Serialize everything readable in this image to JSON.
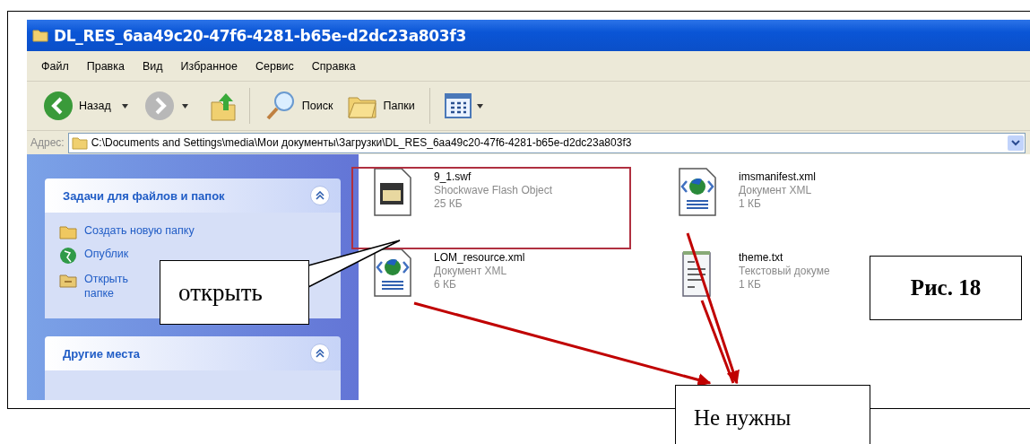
{
  "window": {
    "title": "DL_RES_6aa49c20-47f6-4281-b65e-d2dc23a803f3"
  },
  "menu": [
    "Файл",
    "Правка",
    "Вид",
    "Избранное",
    "Сервис",
    "Справка"
  ],
  "toolbar": {
    "back": "Назад",
    "search": "Поиск",
    "folders": "Папки"
  },
  "address": {
    "label": "Адрес:",
    "value": "C:\\Documents and Settings\\media\\Мои документы\\Загрузки\\DL_RES_6aa49c20-47f6-4281-b65e-d2dc23a803f3"
  },
  "sidebar": {
    "panels": [
      {
        "title": "Задачи для файлов и папок",
        "expanded": true,
        "items": [
          {
            "kind": "folder",
            "lines": [
              "Создать новую папку"
            ]
          },
          {
            "kind": "globe",
            "lines": [
              "Опублик"
            ]
          },
          {
            "kind": "share",
            "lines": [
              "Открыть",
              "папке"
            ]
          }
        ]
      },
      {
        "title": "Другие места",
        "expanded": true
      }
    ]
  },
  "files": [
    {
      "kind": "flash",
      "name": "9_1.swf",
      "type": "Shockwave Flash Object",
      "size": "25 КБ"
    },
    {
      "kind": "xml",
      "name": "imsmanifest.xml",
      "type": "Документ XML",
      "size": "1 КБ"
    },
    {
      "kind": "xml",
      "name": "LOM_resource.xml",
      "type": "Документ XML",
      "size": "6 КБ"
    },
    {
      "kind": "text",
      "name": "theme.txt",
      "type": "Текстовый докуме",
      "size": "1 КБ"
    }
  ],
  "annotations": {
    "callout": "открыть",
    "figure_label": "Рис. 18",
    "note": "Не нужны"
  }
}
